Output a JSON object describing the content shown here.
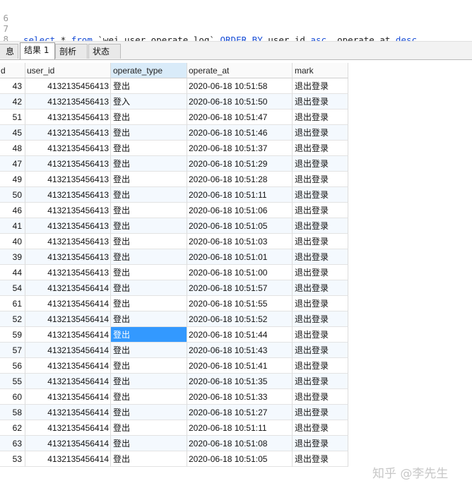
{
  "editor": {
    "lines": [
      {
        "num": "6",
        "text": ""
      },
      {
        "num": "7",
        "text": "select * from `wei_user_operate_log` ORDER BY user_id asc, operate_at desc"
      },
      {
        "num": "8",
        "text": ""
      }
    ]
  },
  "tabs": [
    {
      "label": "息",
      "active": false
    },
    {
      "label": "结果 1",
      "active": true
    },
    {
      "label": "剖析",
      "active": false
    },
    {
      "label": "状态",
      "active": false
    }
  ],
  "table": {
    "headers": [
      "d",
      "user_id",
      "operate_type",
      "operate_at",
      "mark"
    ],
    "selected_header": "operate_type",
    "selected_cell": {
      "row": 16,
      "col": 2
    },
    "rows": [
      [
        "43",
        "4132135456413",
        "登出",
        "2020-06-18 10:51:58",
        "退出登录"
      ],
      [
        "42",
        "4132135456413",
        "登入",
        "2020-06-18 10:51:50",
        "退出登录"
      ],
      [
        "51",
        "4132135456413",
        "登出",
        "2020-06-18 10:51:47",
        "退出登录"
      ],
      [
        "45",
        "4132135456413",
        "登出",
        "2020-06-18 10:51:46",
        "退出登录"
      ],
      [
        "48",
        "4132135456413",
        "登出",
        "2020-06-18 10:51:37",
        "退出登录"
      ],
      [
        "47",
        "4132135456413",
        "登出",
        "2020-06-18 10:51:29",
        "退出登录"
      ],
      [
        "49",
        "4132135456413",
        "登出",
        "2020-06-18 10:51:28",
        "退出登录"
      ],
      [
        "50",
        "4132135456413",
        "登出",
        "2020-06-18 10:51:11",
        "退出登录"
      ],
      [
        "46",
        "4132135456413",
        "登出",
        "2020-06-18 10:51:06",
        "退出登录"
      ],
      [
        "41",
        "4132135456413",
        "登出",
        "2020-06-18 10:51:05",
        "退出登录"
      ],
      [
        "40",
        "4132135456413",
        "登出",
        "2020-06-18 10:51:03",
        "退出登录"
      ],
      [
        "39",
        "4132135456413",
        "登出",
        "2020-06-18 10:51:01",
        "退出登录"
      ],
      [
        "44",
        "4132135456413",
        "登出",
        "2020-06-18 10:51:00",
        "退出登录"
      ],
      [
        "54",
        "4132135456414",
        "登出",
        "2020-06-18 10:51:57",
        "退出登录"
      ],
      [
        "61",
        "4132135456414",
        "登出",
        "2020-06-18 10:51:55",
        "退出登录"
      ],
      [
        "52",
        "4132135456414",
        "登出",
        "2020-06-18 10:51:52",
        "退出登录"
      ],
      [
        "59",
        "4132135456414",
        "登出",
        "2020-06-18 10:51:44",
        "退出登录"
      ],
      [
        "57",
        "4132135456414",
        "登出",
        "2020-06-18 10:51:43",
        "退出登录"
      ],
      [
        "56",
        "4132135456414",
        "登出",
        "2020-06-18 10:51:41",
        "退出登录"
      ],
      [
        "55",
        "4132135456414",
        "登出",
        "2020-06-18 10:51:35",
        "退出登录"
      ],
      [
        "60",
        "4132135456414",
        "登出",
        "2020-06-18 10:51:33",
        "退出登录"
      ],
      [
        "58",
        "4132135456414",
        "登出",
        "2020-06-18 10:51:27",
        "退出登录"
      ],
      [
        "62",
        "4132135456414",
        "登出",
        "2020-06-18 10:51:11",
        "退出登录"
      ],
      [
        "63",
        "4132135456414",
        "登出",
        "2020-06-18 10:51:08",
        "退出登录"
      ],
      [
        "53",
        "4132135456414",
        "登出",
        "2020-06-18 10:51:05",
        "退出登录"
      ]
    ]
  },
  "watermark": "知乎 @李先生",
  "colors": {
    "keyword": "#1a4fd6",
    "selection": "#3399ff",
    "header_selected": "#d9ebf9",
    "alt_row": "#f4f9fe"
  }
}
